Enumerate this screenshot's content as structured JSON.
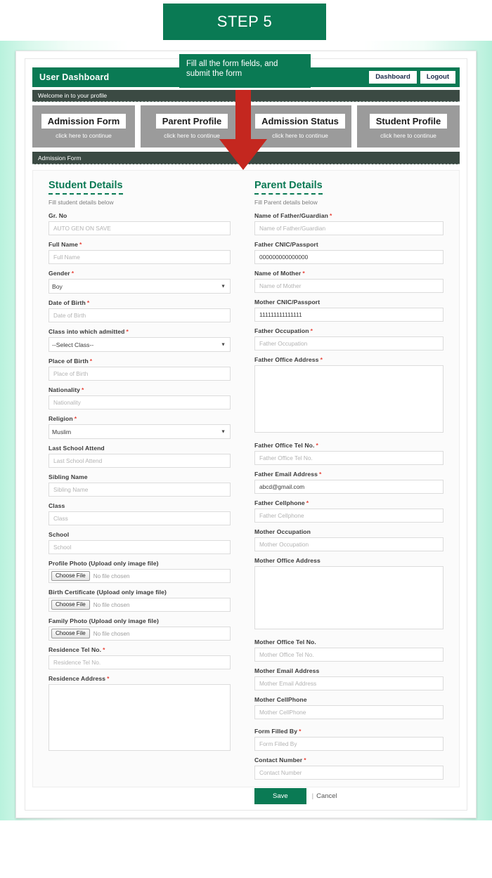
{
  "step_banner": {
    "label": "STEP 5"
  },
  "callout": {
    "text": "Fill all the form fields, and submit the form"
  },
  "appbar": {
    "title": "User Dashboard",
    "dashboard_btn": "Dashboard",
    "logout_btn": "Logout"
  },
  "welcome_strip": {
    "text": "Welcome in to your profile"
  },
  "dashboard_cards": [
    {
      "title": "Admission Form",
      "subtitle": "click here to continue"
    },
    {
      "title": "Parent Profile",
      "subtitle": "click here to continue"
    },
    {
      "title": "Admission Status",
      "subtitle": "click here to continue"
    },
    {
      "title": "Student Profile",
      "subtitle": "click here to continue"
    }
  ],
  "section_strip": {
    "text": "Admission Form"
  },
  "student": {
    "heading": "Student Details",
    "subheading": "Fill student details below",
    "fields": {
      "gr_no": {
        "label": "Gr. No",
        "placeholder": "AUTO GEN ON SAVE",
        "value": ""
      },
      "full_name": {
        "label": "Full Name",
        "placeholder": "Full Name",
        "value": ""
      },
      "gender": {
        "label": "Gender",
        "value": "Boy"
      },
      "dob": {
        "label": "Date of Birth",
        "placeholder": "Date of Birth",
        "value": ""
      },
      "class_admit": {
        "label": "Class into which admitted",
        "value": "--Select Class--"
      },
      "place_birth": {
        "label": "Place of Birth",
        "placeholder": "Place of Birth",
        "value": ""
      },
      "nationality": {
        "label": "Nationality",
        "placeholder": "Nationality",
        "value": ""
      },
      "religion": {
        "label": "Religion",
        "value": "Muslim"
      },
      "last_school": {
        "label": "Last School Attend",
        "placeholder": "Last School Attend",
        "value": ""
      },
      "sibling_name": {
        "label": "Sibling Name",
        "placeholder": "Sibling Name",
        "value": ""
      },
      "class": {
        "label": "Class",
        "placeholder": "Class",
        "value": ""
      },
      "school": {
        "label": "School",
        "placeholder": "School",
        "value": ""
      },
      "profile_photo": {
        "label": "Profile Photo (Upload only image file)",
        "button": "Choose File",
        "file_status": "No file chosen"
      },
      "birth_cert": {
        "label": "Birth Certificate (Upload only image file)",
        "button": "Choose File",
        "file_status": "No file chosen"
      },
      "family_photo": {
        "label": "Family Photo (Upload only image file)",
        "button": "Choose File",
        "file_status": "No file chosen"
      },
      "res_tel": {
        "label": "Residence Tel No.",
        "placeholder": "Residence Tel No.",
        "value": ""
      },
      "res_address": {
        "label": "Residence Address",
        "placeholder": "",
        "value": ""
      }
    }
  },
  "parent": {
    "heading": "Parent Details",
    "subheading": "Fill Parent details below",
    "fields": {
      "father_name": {
        "label": "Name of Father/Guardian",
        "placeholder": "Name of Father/Guardian",
        "value": ""
      },
      "father_cnic": {
        "label": "Father CNIC/Passport",
        "placeholder": "",
        "value": "000000000000000"
      },
      "mother_name": {
        "label": "Name of Mother",
        "placeholder": "Name of Mother",
        "value": ""
      },
      "mother_cnic": {
        "label": "Mother CNIC/Passport",
        "placeholder": "",
        "value": "111111111111111"
      },
      "father_occ": {
        "label": "Father Occupation",
        "placeholder": "Father Occupation",
        "value": ""
      },
      "father_office": {
        "label": "Father Office Address",
        "placeholder": "",
        "value": ""
      },
      "father_off_tel": {
        "label": "Father Office Tel No.",
        "placeholder": "Father Office Tel No.",
        "value": ""
      },
      "father_email": {
        "label": "Father Email Address",
        "placeholder": "",
        "value": "abcd@gmail.com"
      },
      "father_cell": {
        "label": "Father Cellphone",
        "placeholder": "Father Cellphone",
        "value": ""
      },
      "mother_occ": {
        "label": "Mother Occupation",
        "placeholder": "Mother Occupation",
        "value": ""
      },
      "mother_office": {
        "label": "Mother Office Address",
        "placeholder": "",
        "value": ""
      },
      "mother_off_tel": {
        "label": "Mother Office Tel No.",
        "placeholder": "Mother Office Tel No.",
        "value": ""
      },
      "mother_email": {
        "label": "Mother Email Address",
        "placeholder": "Mother Email Address",
        "value": ""
      },
      "mother_cell": {
        "label": "Mother CellPhone",
        "placeholder": "Mother CellPhone",
        "value": ""
      },
      "form_filled_by": {
        "label": "Form Filled By",
        "placeholder": "Form Filled By",
        "value": ""
      },
      "contact_number": {
        "label": "Contact Number",
        "placeholder": "Contact Number",
        "value": ""
      }
    },
    "save_label": "Save",
    "cancel_label": "Cancel",
    "separator": "|"
  },
  "colors": {
    "brand_green": "#0a7a54",
    "dark_strip": "#3b4a43",
    "card_gray": "#9b9b9b",
    "required_red": "#e8443a",
    "arrow_red": "#c4271f"
  }
}
